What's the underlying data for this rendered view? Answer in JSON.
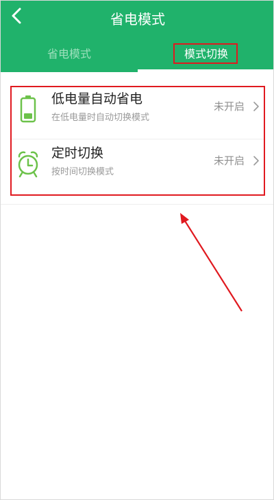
{
  "header": {
    "title": "省电模式",
    "background": "#20b26b"
  },
  "tabs": [
    {
      "label": "省电模式",
      "active": false
    },
    {
      "label": "模式切换",
      "active": true
    }
  ],
  "list": [
    {
      "title": "低电量自动省电",
      "subtitle": "在低电量时自动切换模式",
      "status": "未开启",
      "icon": "battery-icon"
    },
    {
      "title": "定时切换",
      "subtitle": "按时间切换模式",
      "status": "未开启",
      "icon": "alarm-clock-icon"
    }
  ],
  "colors": {
    "accent": "#20b26b",
    "icon": "#6cc24a",
    "annotation": "#e0191f"
  }
}
